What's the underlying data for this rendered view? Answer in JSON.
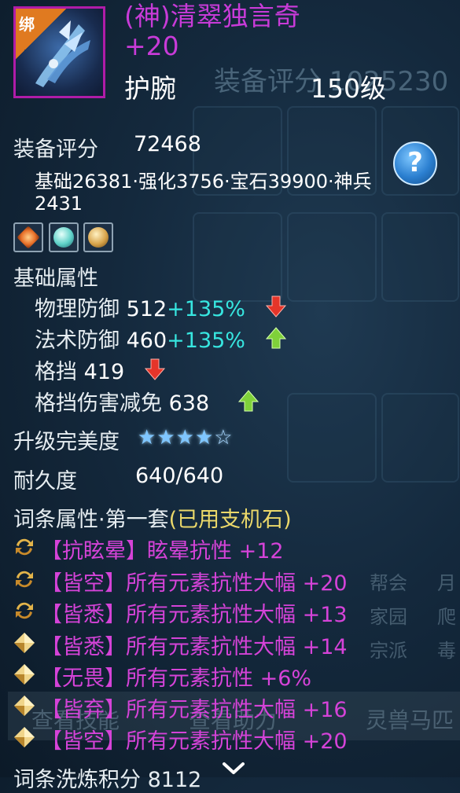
{
  "item": {
    "bind_label": "绑",
    "name": "(神)清翠独言奇 +20",
    "slot": "护腕",
    "level": "150级"
  },
  "score": {
    "label": "装备评分",
    "value": "72468",
    "breakdown": "基础26381·强化3756·宝石39900·神兵2431"
  },
  "gems": [
    {
      "icon": "fire-gem-icon",
      "color": "#e8712a"
    },
    {
      "icon": "water-gem-icon",
      "color": "#5ed1c8"
    },
    {
      "icon": "gold-gem-icon",
      "color": "#d7a34a"
    }
  ],
  "base_attrs": {
    "header": "基础属性",
    "items": [
      {
        "name": "物理防御",
        "value": "512",
        "bonus": "+135%",
        "trend": "down"
      },
      {
        "name": "法术防御",
        "value": "460",
        "bonus": "+135%",
        "trend": "up"
      },
      {
        "name": "格挡",
        "value": "419",
        "bonus": "",
        "trend": "down"
      },
      {
        "name": "格挡伤害减免",
        "value": "638",
        "bonus": "",
        "trend": "up"
      }
    ]
  },
  "perfection": {
    "label": "升级完美度",
    "stars_filled": 4,
    "stars_total": 5
  },
  "durability": {
    "label": "耐久度",
    "value": "640/640"
  },
  "affix": {
    "header_main": "词条属性·第一套",
    "header_note": "(已用支机石)",
    "items": [
      {
        "bullet": "swap-icon",
        "tag": "【抗眩晕】",
        "text": "眩晕抗性 +12"
      },
      {
        "bullet": "swap-icon",
        "tag": "【皆空】",
        "text": "所有元素抗性大幅 +20"
      },
      {
        "bullet": "swap-icon",
        "tag": "【皆悉】",
        "text": "所有元素抗性大幅 +13"
      },
      {
        "bullet": "diamond-icon",
        "tag": "【皆悉】",
        "text": "所有元素抗性大幅 +14"
      },
      {
        "bullet": "diamond-icon",
        "tag": "【无畏】",
        "text": "所有元素抗性 +6%"
      },
      {
        "bullet": "diamond-icon",
        "tag": "【皆弃】",
        "text": "所有元素抗性大幅 +16"
      },
      {
        "bullet": "diamond-icon",
        "tag": "【皆空】",
        "text": "所有元素抗性大幅 +20"
      }
    ]
  },
  "refine_score": "词条洗炼积分 8112",
  "background": {
    "ghost_score": "装备评分 1025230",
    "tabs": [
      "帮会",
      "家园",
      "宗派"
    ],
    "tabs_right": [
      "月",
      "爬",
      "毒"
    ],
    "buttons": [
      "查看技能",
      "查看助力",
      "灵兽马匹"
    ]
  }
}
